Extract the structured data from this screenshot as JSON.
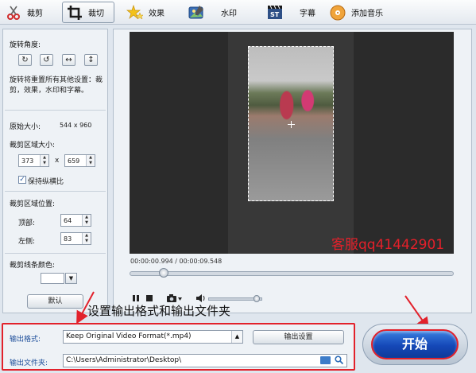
{
  "toolbar": {
    "tabs": [
      {
        "label": "裁剪",
        "icon": "scissors-icon"
      },
      {
        "label": "裁切",
        "icon": "crop-icon"
      },
      {
        "label": "效果",
        "icon": "stars-icon"
      },
      {
        "label": "水印",
        "icon": "watermark-icon"
      },
      {
        "label": "字幕",
        "icon": "subtitle-icon"
      },
      {
        "label": "添加音乐",
        "icon": "music-icon"
      }
    ],
    "active_tab": "裁切"
  },
  "left_panel": {
    "rotation_title": "旋转角度:",
    "rotation_buttons": [
      "↻",
      "↺",
      "↔",
      "↕"
    ],
    "rotation_note": "旋转将重置所有其他设置：裁剪，效果，水印和字幕。",
    "original_size_label": "原始大小:",
    "original_size_value": "544 x 960",
    "crop_size_label": "裁剪区域大小:",
    "crop_width": "373",
    "crop_x": "x",
    "crop_height": "659",
    "keep_ratio_label": "保持纵横比",
    "keep_ratio_checked": "✓",
    "crop_position_label": "裁剪区域位置:",
    "top_label": "顶部:",
    "top_value": "64",
    "left_label": "左侧:",
    "left_value": "83",
    "line_color_label": "裁剪线条颜色:",
    "default_button": "默认"
  },
  "preview": {
    "watermark": "客服qq41442901",
    "timecode": "00:00:00.994 / 00:00:09.548",
    "play_fraction": 0.105,
    "volume_fraction": 0.9
  },
  "annotation": {
    "text": "设置输出格式和输出文件夹"
  },
  "output": {
    "format_label": "输出格式:",
    "format_value": "Keep Original Video Format(*.mp4)",
    "settings_button": "输出设置",
    "folder_label": "输出文件夹:",
    "folder_value": "C:\\Users\\Administrator\\Desktop\\"
  },
  "start_button": "开始",
  "colors": {
    "highlight_red": "#e2212b",
    "start_blue": "#1548b8",
    "label_blue": "#1d4e9a"
  }
}
